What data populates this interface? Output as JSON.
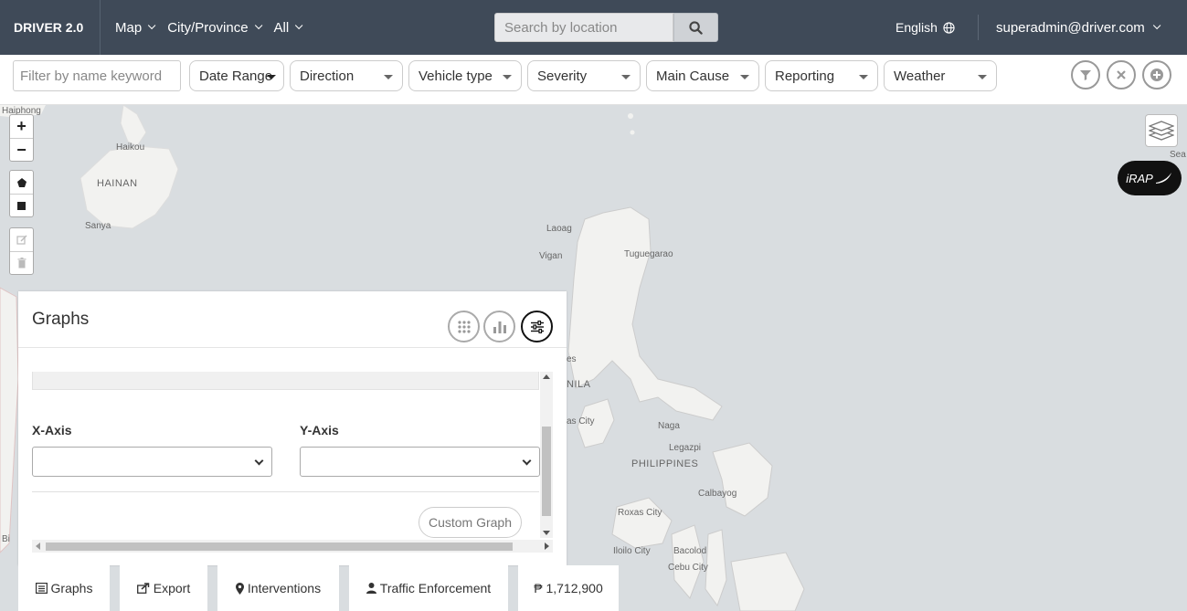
{
  "nav": {
    "brand": "DRIVER 2.0",
    "menus": [
      {
        "label": "Map"
      },
      {
        "label": "City/Province"
      },
      {
        "label": "All"
      }
    ],
    "search_placeholder": "Search by location",
    "language": "English",
    "user": "superadmin@driver.com"
  },
  "filters": {
    "keyword_placeholder": "Filter by name keyword",
    "selects": [
      {
        "label": "Date Range"
      },
      {
        "label": "Direction"
      },
      {
        "label": "Vehicle type"
      },
      {
        "label": "Severity"
      },
      {
        "label": "Main Cause"
      },
      {
        "label": "Reporting"
      },
      {
        "label": "Weather"
      }
    ]
  },
  "map": {
    "zoom_in": "+",
    "zoom_out": "−",
    "irap": "iRAP",
    "labels": {
      "haiphong": "Haiphong",
      "haikou": "Haikou",
      "hainan": "HAINAN",
      "sanya": "Sanya",
      "laoag": "Laoag",
      "vigan": "Vigan",
      "tuguegarao": "Tuguegarao",
      "manila": "NILA",
      "quezon": "as City",
      "naga": "Naga",
      "legazpi": "Legazpi",
      "philippines": "PHILIPPINES",
      "calbayog": "Calbayog",
      "roxas": "Roxas City",
      "iloilo": "Iloilo City",
      "bacolod": "Bacolod",
      "cebu": "Cebu City",
      "sea": "Sea",
      "es": "es",
      "bi": "Bi"
    }
  },
  "graphs": {
    "title": "Graphs",
    "x_axis_label": "X-Axis",
    "y_axis_label": "Y-Axis",
    "custom_button": "Custom Graph"
  },
  "bottom_tabs": [
    {
      "label": "Graphs"
    },
    {
      "label": "Export"
    },
    {
      "label": "Interventions"
    },
    {
      "label": "Traffic Enforcement"
    },
    {
      "label": "₱ 1,712,900"
    }
  ]
}
